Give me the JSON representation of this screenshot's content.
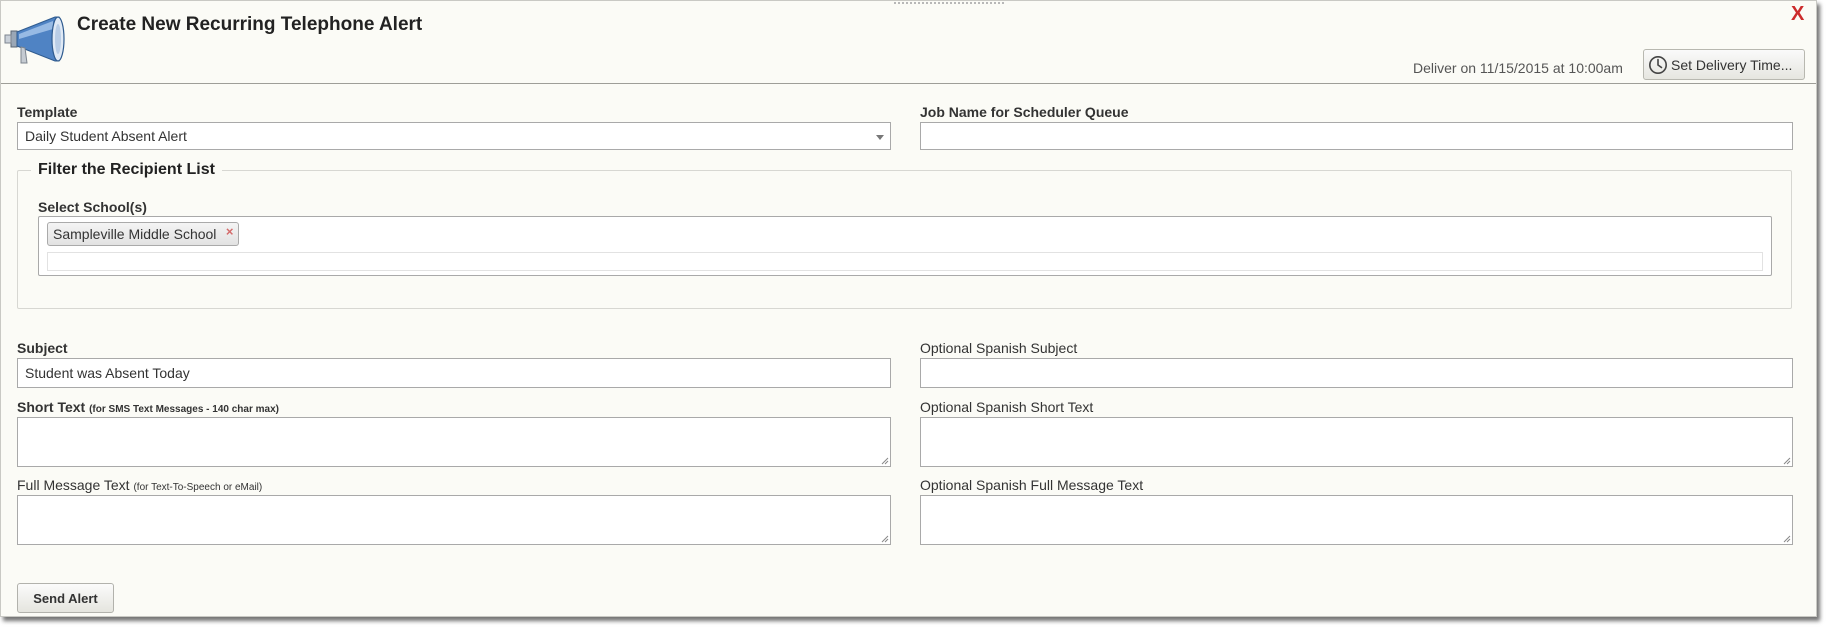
{
  "dialog": {
    "title": "Create New Recurring Telephone Alert",
    "close_label": "X",
    "header_icon": "megaphone-icon",
    "delivery": {
      "text": "Deliver on 11/15/2015 at 10:00am",
      "button_label": "Set Delivery Time...",
      "button_icon": "clock-icon"
    }
  },
  "form": {
    "template": {
      "label": "Template",
      "value": "Daily Student Absent Alert"
    },
    "job_name": {
      "label": "Job Name for Scheduler Queue",
      "value": ""
    },
    "filter": {
      "legend": "Filter the Recipient List",
      "schools_label": "Select School(s)",
      "selected_schools": [
        "Sampleville Middle School"
      ],
      "remove_symbol": "×"
    },
    "subject": {
      "label": "Subject",
      "value": "Student was Absent Today"
    },
    "spanish_subject": {
      "label": "Optional Spanish Subject",
      "value": ""
    },
    "short_text": {
      "label": "Short Text",
      "hint": "(for SMS Text Messages - 140 char max)",
      "value": ""
    },
    "spanish_short_text": {
      "label": "Optional Spanish Short Text",
      "value": ""
    },
    "full_text": {
      "label": "Full Message Text",
      "hint": "(for Text-To-Speech or eMail)",
      "value": ""
    },
    "spanish_full_text": {
      "label": "Optional Spanish Full Message Text",
      "value": ""
    },
    "send_label": "Send Alert"
  },
  "colors": {
    "background": "#fbfbf6",
    "close": "#cc2b2b",
    "megaphone": "#4f83c4"
  }
}
